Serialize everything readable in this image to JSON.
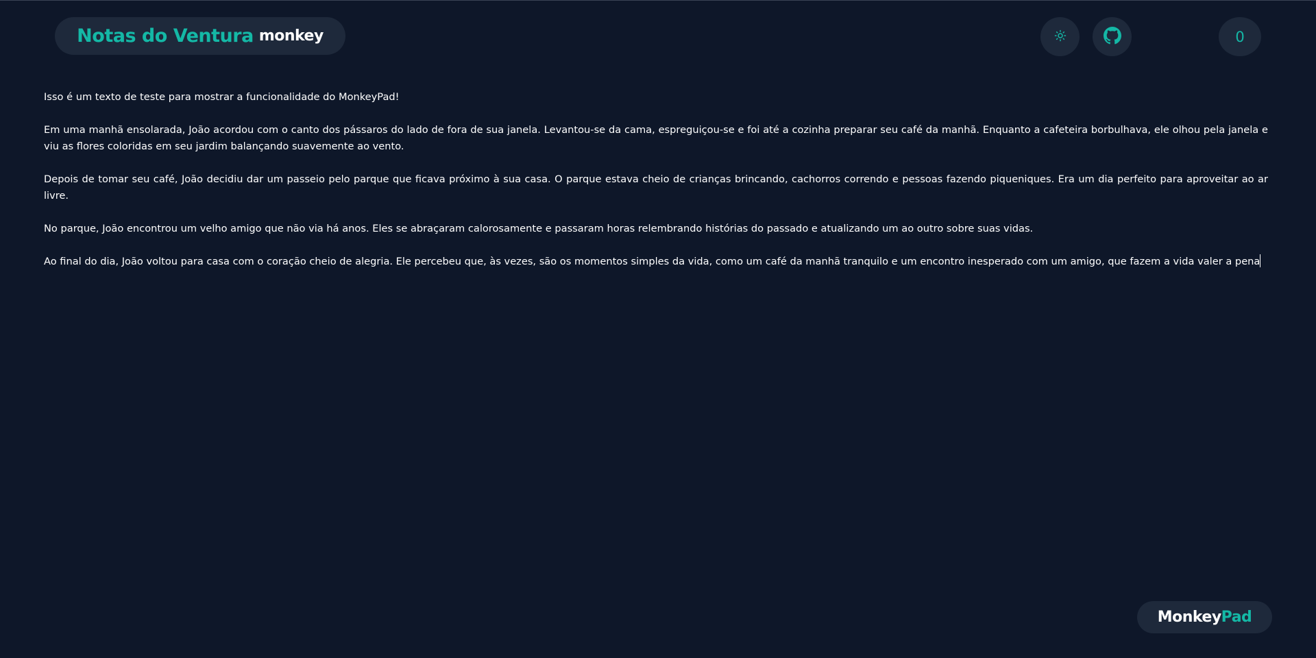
{
  "header": {
    "title": "Notas do Ventura",
    "subtitle": "monkey",
    "theme_toggle_icon": "sun-icon",
    "github_icon": "github-icon",
    "counter": "0"
  },
  "editor": {
    "paragraphs": [
      "Isso é um texto de teste para mostrar a funcionalidade do  MonkeyPad!",
      "Em uma manhã ensolarada, João acordou com o canto dos pássaros do lado de fora de sua janela. Levantou-se da cama, espreguiçou-se e foi até a cozinha preparar seu café da manhã. Enquanto a cafeteira borbulhava, ele olhou pela janela e viu as flores coloridas em seu jardim balançando suavemente ao vento.",
      "Depois de tomar seu café, João decidiu dar um passeio pelo parque que ficava próximo à sua casa. O parque estava cheio de crianças brincando, cachorros correndo e pessoas fazendo piqueniques. Era um dia perfeito para aproveitar ao ar livre.",
      "No parque, João encontrou um velho amigo que não via há anos. Eles se abraçaram calorosamente e passaram horas relembrando histórias do passado e atualizando um ao outro sobre suas vidas.",
      "Ao final do dia, João voltou para casa com o coração cheio de alegria. Ele percebeu que, às vezes, são os momentos simples da vida, como um café da manhã tranquilo e um encontro inesperado com um amigo, que fazem a vida valer a pena"
    ]
  },
  "footer": {
    "brand_part1": "Monkey",
    "brand_part2": "Pad"
  },
  "colors": {
    "background": "#0e1729",
    "pill": "#1e293b",
    "accent": "#14b8a6",
    "text": "#ffffff"
  }
}
